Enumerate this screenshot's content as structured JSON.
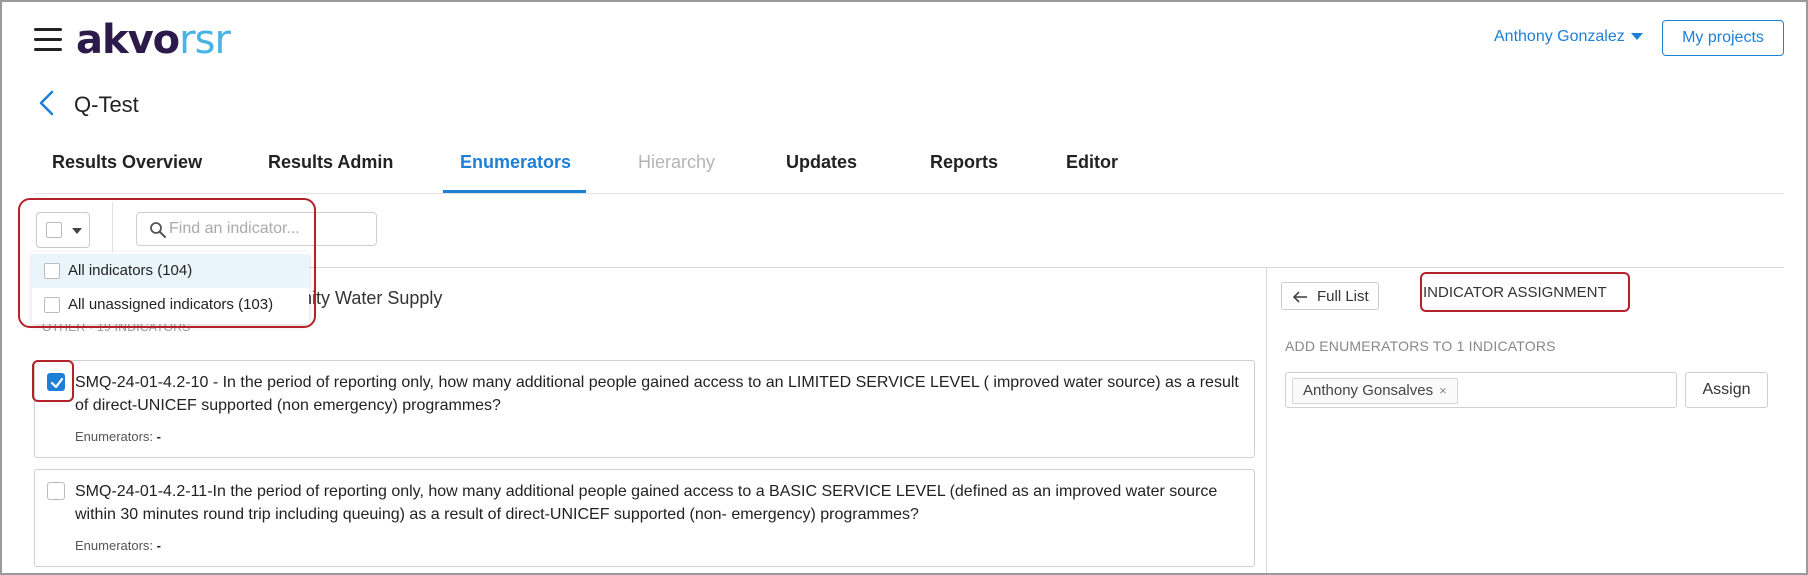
{
  "header": {
    "logo_part1": "akvo",
    "logo_part2": "rsr",
    "user_name": "Anthony Gonzalez",
    "my_projects_label": "My projects"
  },
  "breadcrumb": {
    "project_title": "Q-Test"
  },
  "tabs": [
    {
      "label": "Results Overview",
      "state": "normal"
    },
    {
      "label": "Results Admin",
      "state": "normal"
    },
    {
      "label": "Enumerators",
      "state": "active"
    },
    {
      "label": "Hierarchy",
      "state": "disabled"
    },
    {
      "label": "Updates",
      "state": "normal"
    },
    {
      "label": "Reports",
      "state": "normal"
    },
    {
      "label": "Editor",
      "state": "normal"
    }
  ],
  "search": {
    "placeholder": "Find an indicator..."
  },
  "select_dropdown": {
    "items": [
      {
        "label": "All indicators (104)",
        "highlighted": true
      },
      {
        "label": "All unassigned indicators (103)",
        "highlighted": false
      }
    ]
  },
  "group": {
    "title": "nity Water Supply",
    "subtitle": "OTHER · 19 INDICATORS"
  },
  "indicators": [
    {
      "text": "SMQ-24-01-4.2-10 - In the period of reporting only, how many additional people gained access to an LIMITED SERVICE LEVEL ( improved water source) as a result of direct-UNICEF supported (non emergency) programmes?",
      "enumerators_label": "Enumerators:",
      "enumerators_value": "-",
      "checked": true
    },
    {
      "text": "SMQ-24-01-4.2-11-In the period of reporting only, how many additional people gained access to a BASIC SERVICE LEVEL (defined as an improved water source within 30 minutes round trip including queuing) as a result of direct-UNICEF supported (non- emergency) programmes?",
      "enumerators_label": "Enumerators:",
      "enumerators_value": "-",
      "checked": false
    }
  ],
  "assignment": {
    "full_list_label": "Full List",
    "heading": "INDICATOR ASSIGNMENT",
    "add_label": "ADD ENUMERATORS TO 1 INDICATORS",
    "selected_enumerator": "Anthony Gonsalves",
    "remove_symbol": "×",
    "assign_label": "Assign"
  },
  "colors": {
    "accent": "#1e7fd6",
    "logo_dark": "#2c1a4a",
    "logo_light": "#4ab3e6",
    "annotation": "#b3222a"
  }
}
